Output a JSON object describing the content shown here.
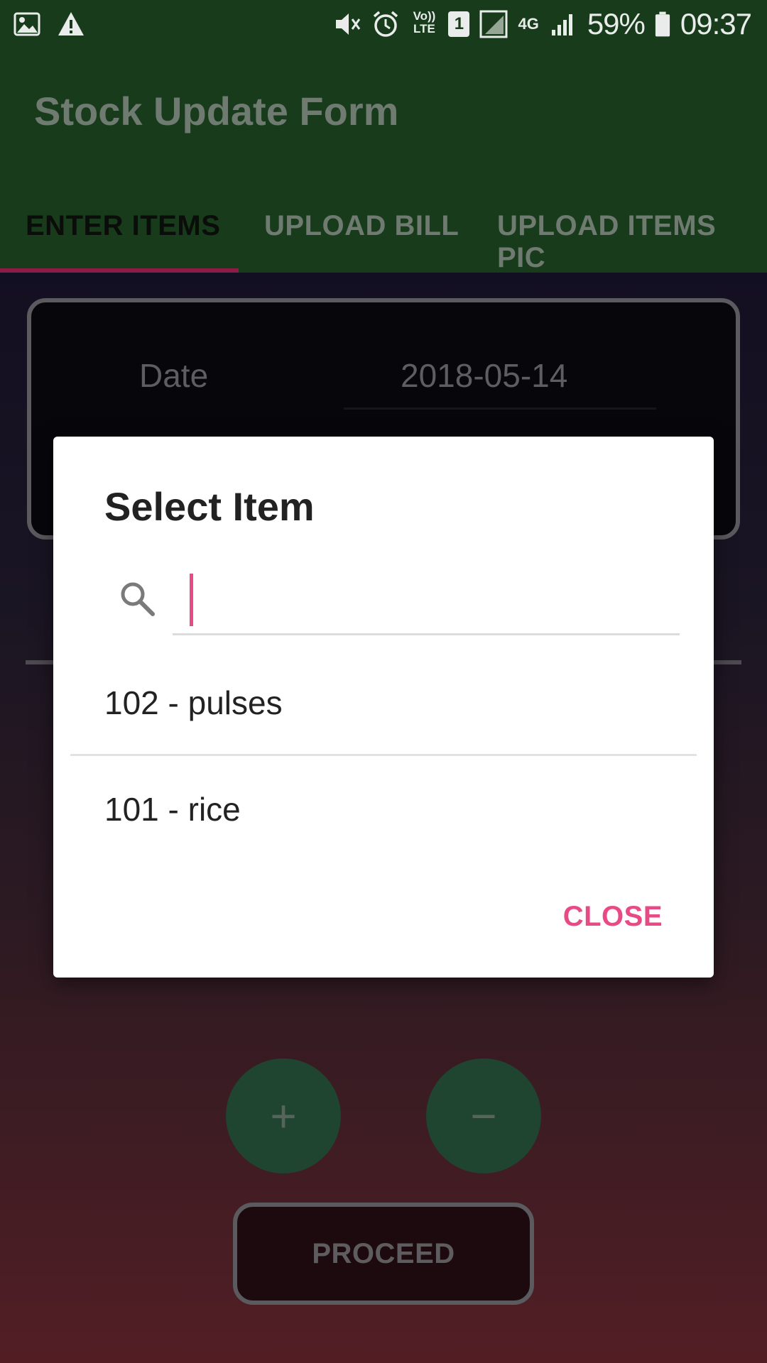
{
  "status_bar": {
    "battery": "59%",
    "time": "09:37",
    "network": "4G",
    "lte_label": "Vo)) LTE",
    "sim": "1",
    "icons": [
      "image-icon",
      "warning-icon",
      "mute-icon",
      "alarm-icon",
      "volte-icon",
      "sim-icon",
      "signal-icon",
      "battery-icon"
    ]
  },
  "app_bar": {
    "title": "Stock Update Form"
  },
  "tabs": [
    {
      "label": "ENTER ITEMS",
      "active": true
    },
    {
      "label": "UPLOAD BILL",
      "active": false
    },
    {
      "label": "UPLOAD ITEMS PIC",
      "active": false
    }
  ],
  "form": {
    "date_label": "Date",
    "date_value": "2018-05-14",
    "add_symbol": "+",
    "remove_symbol": "−",
    "proceed_label": "PROCEED"
  },
  "dialog": {
    "title": "Select Item",
    "search_placeholder": "",
    "items": [
      {
        "label": "102 - pulses"
      },
      {
        "label": "101 - rice"
      }
    ],
    "close_label": "CLOSE"
  },
  "colors": {
    "app_bar": "#183c1b",
    "accent": "#e84a86",
    "tab_indicator": "#8a1c45",
    "fab": "#1f4430"
  }
}
